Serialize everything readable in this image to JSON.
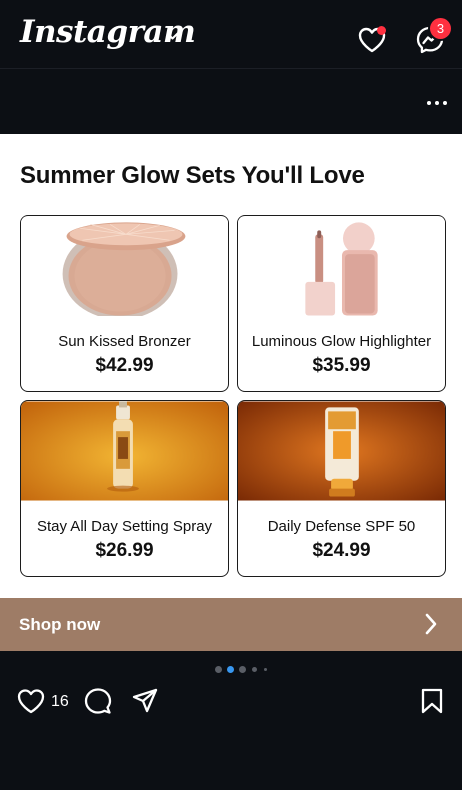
{
  "header": {
    "logo": "Instagram",
    "messages_badge": "3"
  },
  "ad": {
    "title": "Summer Glow Sets You'll Love",
    "products": [
      {
        "name": "Sun Kissed Bronzer",
        "price": "$42.99"
      },
      {
        "name": "Luminous Glow Highlighter",
        "price": "$35.99"
      },
      {
        "name": "Stay All Day Setting Spray",
        "price": "$26.99"
      },
      {
        "name": "Daily Defense SPF 50",
        "price": "$24.99"
      }
    ],
    "shop_label": "Shop now",
    "shop_color": "#9e7c66"
  },
  "actions": {
    "likes": "16"
  },
  "carousel": {
    "total_dots": 5,
    "active_dot": 2
  },
  "colors": {
    "background": "#0c0f14",
    "notification": "#ff3040",
    "carousel_active": "#3897f0"
  }
}
